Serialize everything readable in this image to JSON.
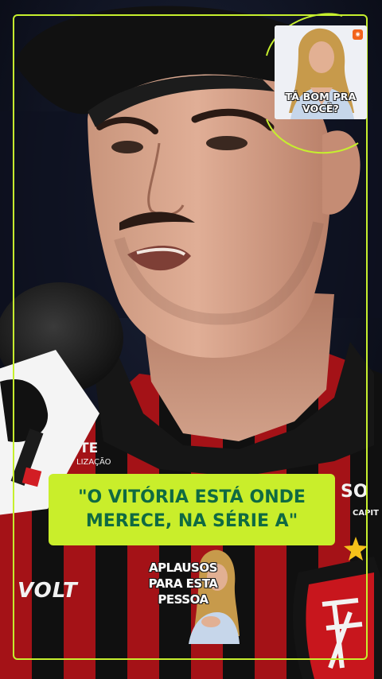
{
  "overlay": {
    "quote_line1": "\"O VITÓRIA ESTÁ ONDE",
    "quote_line2": "MERECE, NA SÉRIE A\"",
    "pip_caption": "TÁ BOM PRA VOCÊ?",
    "reaction_line1": "APLAUSOS",
    "reaction_line2": "PARA ESTA",
    "reaction_line3": "PESSOA"
  },
  "shirt": {
    "sponsor_left": "VOLT",
    "sponsor_right": "SO",
    "sponsor_right_sub": "CAPIT",
    "collar_text": "TE",
    "collar_sub": "LIZAÇÃO"
  },
  "colors": {
    "accent": "#c9ee2b",
    "quote_text": "#0f6a42",
    "club_red": "#c8161d",
    "club_black": "#141414"
  },
  "icons": {
    "pip_logo": "app-logo-icon",
    "club_crest": "club-crest-icon",
    "microphone": "microphone-icon"
  }
}
